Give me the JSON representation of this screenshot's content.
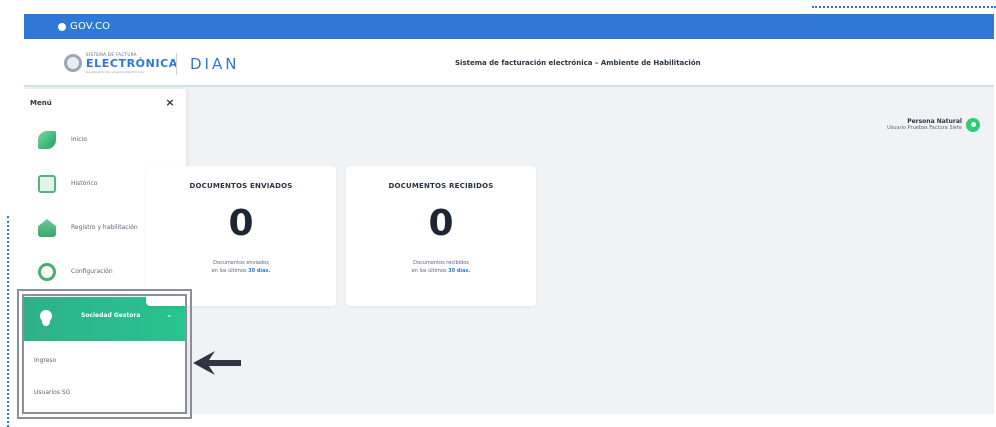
{
  "gov_bar": {
    "label": "GOV.CO",
    "icon": "gov-co-icon",
    "color": "#2f78d6"
  },
  "header": {
    "logo_fe": {
      "small": "SISTEMA DE FACTURA",
      "big": "ELECTRÓNICA",
      "sub": "Gestionando Documentos Electrónicos"
    },
    "logo_dian": "DIAN",
    "title": "Sistema de facturación electrónica – Ambiente de Habilitación"
  },
  "sidebar": {
    "title": "Menú",
    "close_icon": "×",
    "items": [
      {
        "label": "Inicio",
        "icon": "leaf-icon",
        "chevron": ""
      },
      {
        "label": "Histórico",
        "icon": "document-icon",
        "chevron": "⌃"
      },
      {
        "label": "Registro y habilitación",
        "icon": "building-icon",
        "chevron": "⌃"
      },
      {
        "label": "Configuración",
        "icon": "gear-icon",
        "chevron": "⌃"
      },
      {
        "label": "Sociedad Gestora",
        "icon": "users-icon",
        "chevron": "⌄"
      }
    ],
    "subitems": [
      {
        "label": "Ingreso"
      },
      {
        "label": "Usuarios SG"
      }
    ],
    "active_color": "#28c48f"
  },
  "user": {
    "name": "Persona Natural",
    "subtitle": "Usuario Pruebas Factura Siete",
    "avatar_icon": "user-icon",
    "avatar_color": "#2ecc71"
  },
  "cards": {
    "sent": {
      "title": "DOCUMENTOS ENVIADOS",
      "count": "0",
      "desc_line1": "Documentos enviados",
      "desc_line2_prefix": "en los últimos ",
      "desc_line2_highlight": "30 días."
    },
    "received": {
      "title": "DOCUMENTOS RECIBIDOS",
      "count": "0",
      "desc_line1": "Documentos recibidos",
      "desc_line2_prefix": "en los últimos ",
      "desc_line2_highlight": "30 días."
    }
  },
  "annotation": {
    "arrow_icon": "arrow-left-icon",
    "highlight_box": "highlight-box"
  }
}
